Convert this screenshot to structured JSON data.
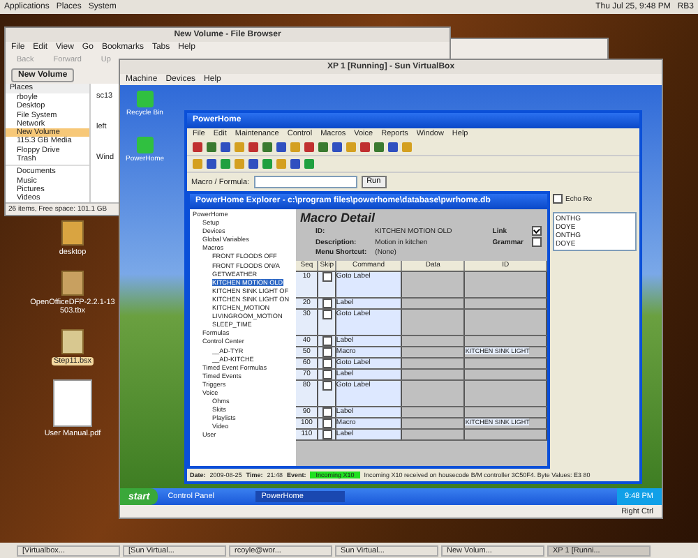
{
  "top_panel": {
    "menus": [
      "Applications",
      "Places",
      "System"
    ],
    "clock": "Thu Jul 25, 9:48 PM",
    "user": "RB3"
  },
  "file_browser": {
    "title": "New Volume - File Browser",
    "menu": [
      "File",
      "Edit",
      "View",
      "Go",
      "Bookmarks",
      "Tabs",
      "Help"
    ],
    "nav": [
      "Back",
      "Forward",
      "Up"
    ],
    "location": "New Volume",
    "places_title": "Places",
    "places": [
      {
        "label": "rboyle",
        "selected": false
      },
      {
        "label": "Desktop",
        "selected": false
      },
      {
        "label": "File System",
        "selected": false
      },
      {
        "label": "Network",
        "selected": false
      },
      {
        "label": "New Volume",
        "selected": true
      },
      {
        "label": "115.3 GB Media",
        "selected": false
      },
      {
        "label": "Floppy Drive",
        "selected": false
      },
      {
        "label": "Trash",
        "selected": false
      }
    ],
    "bookmarks": [
      "Documents",
      "Music",
      "Pictures",
      "Videos"
    ],
    "files": [
      "sc13",
      "left",
      "Wind"
    ],
    "status": "26 items, Free space: 101.1 GB"
  },
  "desktop_icons": [
    {
      "label": "desktop",
      "kind": "folder",
      "selected": false
    },
    {
      "label": "OpenOfficeDFP-2.2.1-13503.tbx",
      "kind": "package",
      "selected": false
    },
    {
      "label": "Step11.bsx",
      "kind": "file",
      "selected": true
    },
    {
      "label": "User Manual.pdf",
      "kind": "document",
      "selected": false
    }
  ],
  "virtualbox": {
    "title": "XP 1 [Running] - Sun VirtualBox",
    "menu": [
      "Machine",
      "Devices",
      "Help"
    ],
    "host_key": "Right Ctrl"
  },
  "xp_icons": [
    "Recycle Bin",
    "PowerHome"
  ],
  "powerhome": {
    "title": "PowerHome",
    "menu": [
      "File",
      "Edit",
      "Maintenance",
      "Control",
      "Macros",
      "Voice",
      "Reports",
      "Window",
      "Help"
    ],
    "formula_label": "Macro / Formula:",
    "run": "Run",
    "explorer": {
      "title": "PowerHome Explorer - c:\\program files\\powerhome\\database\\pwrhome.db",
      "tree": [
        {
          "label": "PowerHome",
          "selected": false,
          "children": [
            {
              "label": "Setup",
              "selected": false
            },
            {
              "label": "Devices",
              "selected": false
            },
            {
              "label": "Global Variables",
              "selected": false
            },
            {
              "label": "Macros",
              "selected": false,
              "children": [
                {
                  "label": "FRONT FLOODS OFF",
                  "selected": false
                },
                {
                  "label": "FRONT FLOODS ON/A",
                  "selected": false
                },
                {
                  "label": "GETWEATHER",
                  "selected": false
                },
                {
                  "label": "KITCHEN MOTION OLD",
                  "selected": true
                },
                {
                  "label": "KITCHEN SINK LIGHT OF",
                  "selected": false
                },
                {
                  "label": "KITCHEN SINK LIGHT ON",
                  "selected": false
                },
                {
                  "label": "KITCHEN_MOTION",
                  "selected": false
                },
                {
                  "label": "LIVINGROOM_MOTION",
                  "selected": false
                },
                {
                  "label": "SLEEP_TIME",
                  "selected": false
                }
              ]
            },
            {
              "label": "Formulas",
              "selected": false
            },
            {
              "label": "Control Center",
              "selected": false,
              "children": [
                {
                  "label": "__AD-TYR",
                  "selected": false
                },
                {
                  "label": "__AD-KITCHE",
                  "selected": false
                }
              ]
            },
            {
              "label": "Timed Event Formulas",
              "selected": false
            },
            {
              "label": "Timed Events",
              "selected": false
            },
            {
              "label": "Triggers",
              "selected": false
            },
            {
              "label": "Voice",
              "selected": false,
              "children": [
                {
                  "label": "Ohms",
                  "selected": false
                },
                {
                  "label": "Skits",
                  "selected": false
                },
                {
                  "label": "Playlists",
                  "selected": false
                },
                {
                  "label": "Video",
                  "selected": false
                }
              ]
            },
            {
              "label": "User",
              "selected": false
            }
          ]
        }
      ],
      "detail_title": "Macro Detail",
      "id_label": "ID:",
      "id": "KITCHEN MOTION OLD",
      "desc_label": "Description:",
      "desc": "Motion in kitchen",
      "shortcut_label": "Menu Shortcut:",
      "shortcut": "(None)",
      "link_label": "Link",
      "link": true,
      "grammar_label": "Grammar",
      "grammar": false,
      "columns": [
        "Seq",
        "Skip",
        "Command",
        "Data",
        "ID"
      ],
      "rows": [
        {
          "seq": "10",
          "skip": false,
          "command": "Goto Label",
          "id": "",
          "tall": true
        },
        {
          "seq": "20",
          "skip": false,
          "command": "Label",
          "id": "",
          "tall": false
        },
        {
          "seq": "30",
          "skip": false,
          "command": "Goto Label",
          "id": "",
          "tall": true
        },
        {
          "seq": "40",
          "skip": false,
          "command": "Label",
          "id": "",
          "tall": false
        },
        {
          "seq": "50",
          "skip": false,
          "command": "Macro",
          "id": "KITCHEN SINK LIGHT",
          "tall": false
        },
        {
          "seq": "60",
          "skip": false,
          "command": "Goto Label",
          "id": "",
          "tall": false
        },
        {
          "seq": "70",
          "skip": false,
          "command": "Label",
          "id": "",
          "tall": false
        },
        {
          "seq": "80",
          "skip": false,
          "command": "Goto Label",
          "id": "",
          "tall": true
        },
        {
          "seq": "90",
          "skip": false,
          "command": "Label",
          "id": "",
          "tall": false
        },
        {
          "seq": "100",
          "skip": false,
          "command": "Macro",
          "id": "KITCHEN SINK LIGHT",
          "tall": false
        },
        {
          "seq": "110",
          "skip": false,
          "command": "Label",
          "id": "",
          "tall": false
        }
      ]
    },
    "side_option": "Echo Re",
    "side_option_checked": false,
    "side_list": [
      "ONTHG",
      "DOYE",
      "ONTHG",
      "DOYE"
    ],
    "status": {
      "date_label": "Date:",
      "date": "2009-08-25",
      "time_label": "Time:",
      "time": "21:48",
      "event_label": "Event:",
      "event": "Incoming X10",
      "message": "Incoming X10 received on housecode B/M controller 3C50F4. Byte Values: E3 80"
    }
  },
  "xp_taskbar": {
    "start": "start",
    "tasks": [
      {
        "label": "Control Panel",
        "selected": false
      },
      {
        "label": "PowerHome",
        "selected": true
      }
    ],
    "clock": "9:48 PM"
  },
  "bottom_panel": [
    {
      "label": "[Virtualbox...",
      "selected": false
    },
    {
      "label": "[Sun Virtual...",
      "selected": false
    },
    {
      "label": "rcoyle@wor...",
      "selected": false
    },
    {
      "label": "Sun Virtual...",
      "selected": false
    },
    {
      "label": "New Volum...",
      "selected": false
    },
    {
      "label": "XP 1 [Runni...",
      "selected": true
    }
  ]
}
